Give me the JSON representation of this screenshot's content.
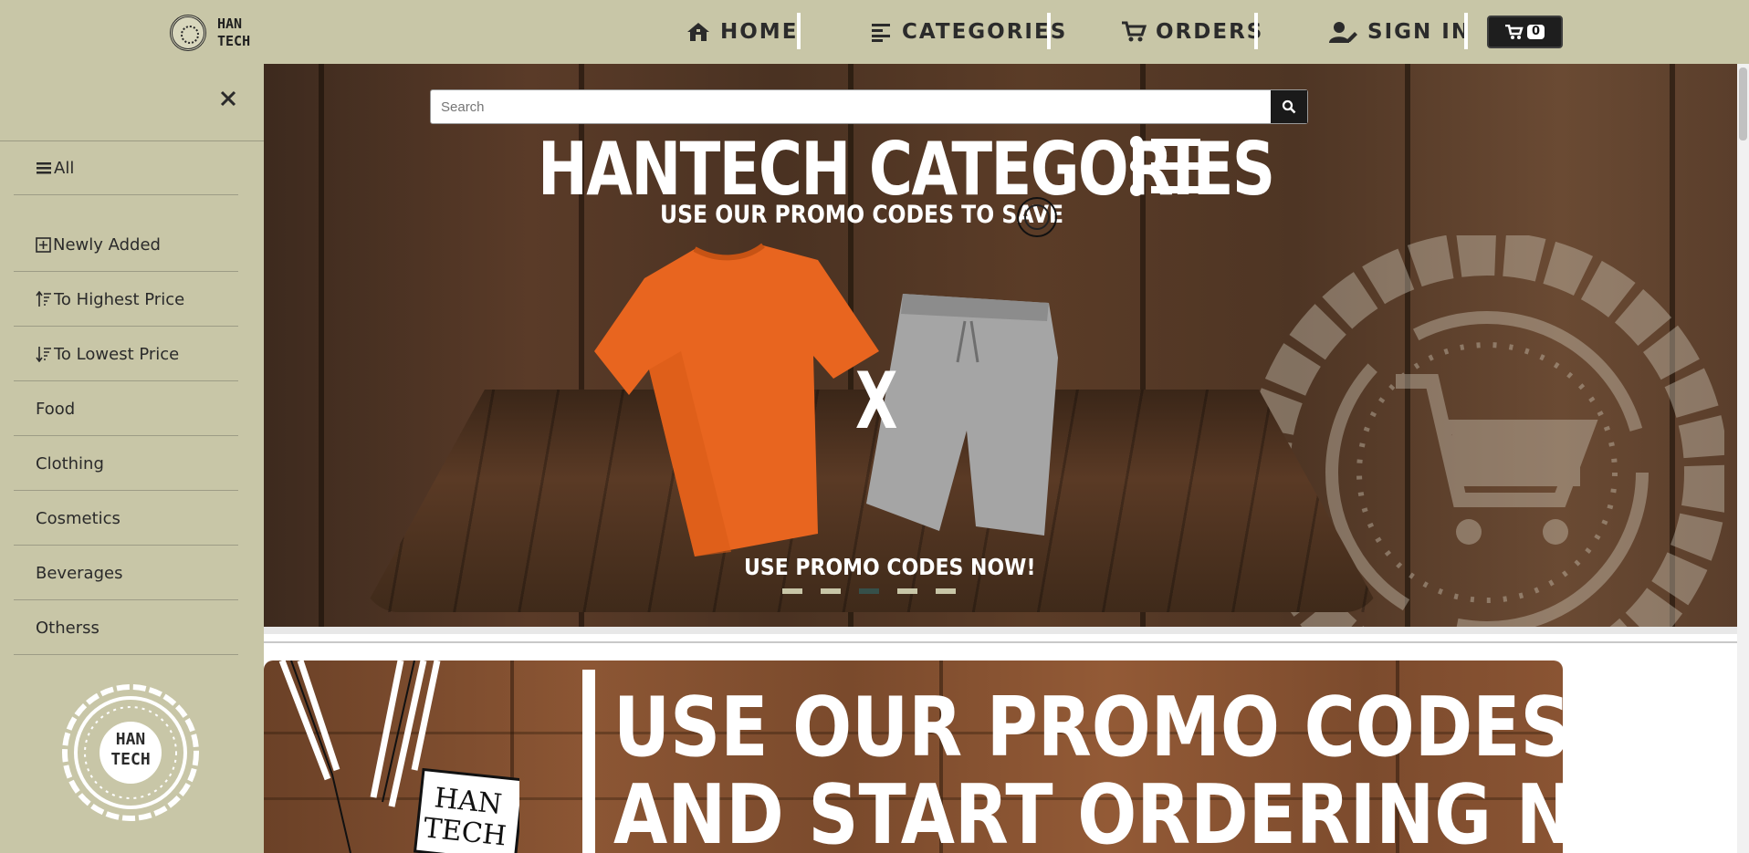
{
  "brand": {
    "name": "HAN\nTECH"
  },
  "nav": {
    "home": "HOME",
    "categories": "CATEGORIES",
    "orders": "ORDERS",
    "sign_in": "SIGN IN",
    "cart_count": "0"
  },
  "sidebar": {
    "items": [
      {
        "label": "All",
        "icon": "bars-icon"
      },
      {
        "label": "Newly Added",
        "icon": "plus-square-icon"
      },
      {
        "label": "To Highest Price",
        "icon": "sort-up-icon"
      },
      {
        "label": "To Lowest Price",
        "icon": "sort-down-icon"
      },
      {
        "label": "Food"
      },
      {
        "label": "Clothing"
      },
      {
        "label": "Cosmetics"
      },
      {
        "label": "Beverages"
      },
      {
        "label": "Otherss"
      }
    ],
    "logo_text": "HAN\nTECH"
  },
  "search": {
    "placeholder": "Search",
    "value": ""
  },
  "hero": {
    "title": "HANTECH CATEGORIES",
    "subtitle": "USE OUR PROMO CODES TO SAVE",
    "x_mark": "X",
    "caption": "USE PROMO CODES NOW!",
    "slides": 5,
    "active_slide": 3
  },
  "promo_banner": {
    "line1": "USE OUR PROMO CODES",
    "line2": "AND START ORDERING NOW",
    "tag_text": "HAN\nTECH"
  },
  "colors": {
    "nav_bg": "#c8c6a7",
    "accent_dark": "#1e1e1e",
    "indicator_active": "#36504a"
  }
}
